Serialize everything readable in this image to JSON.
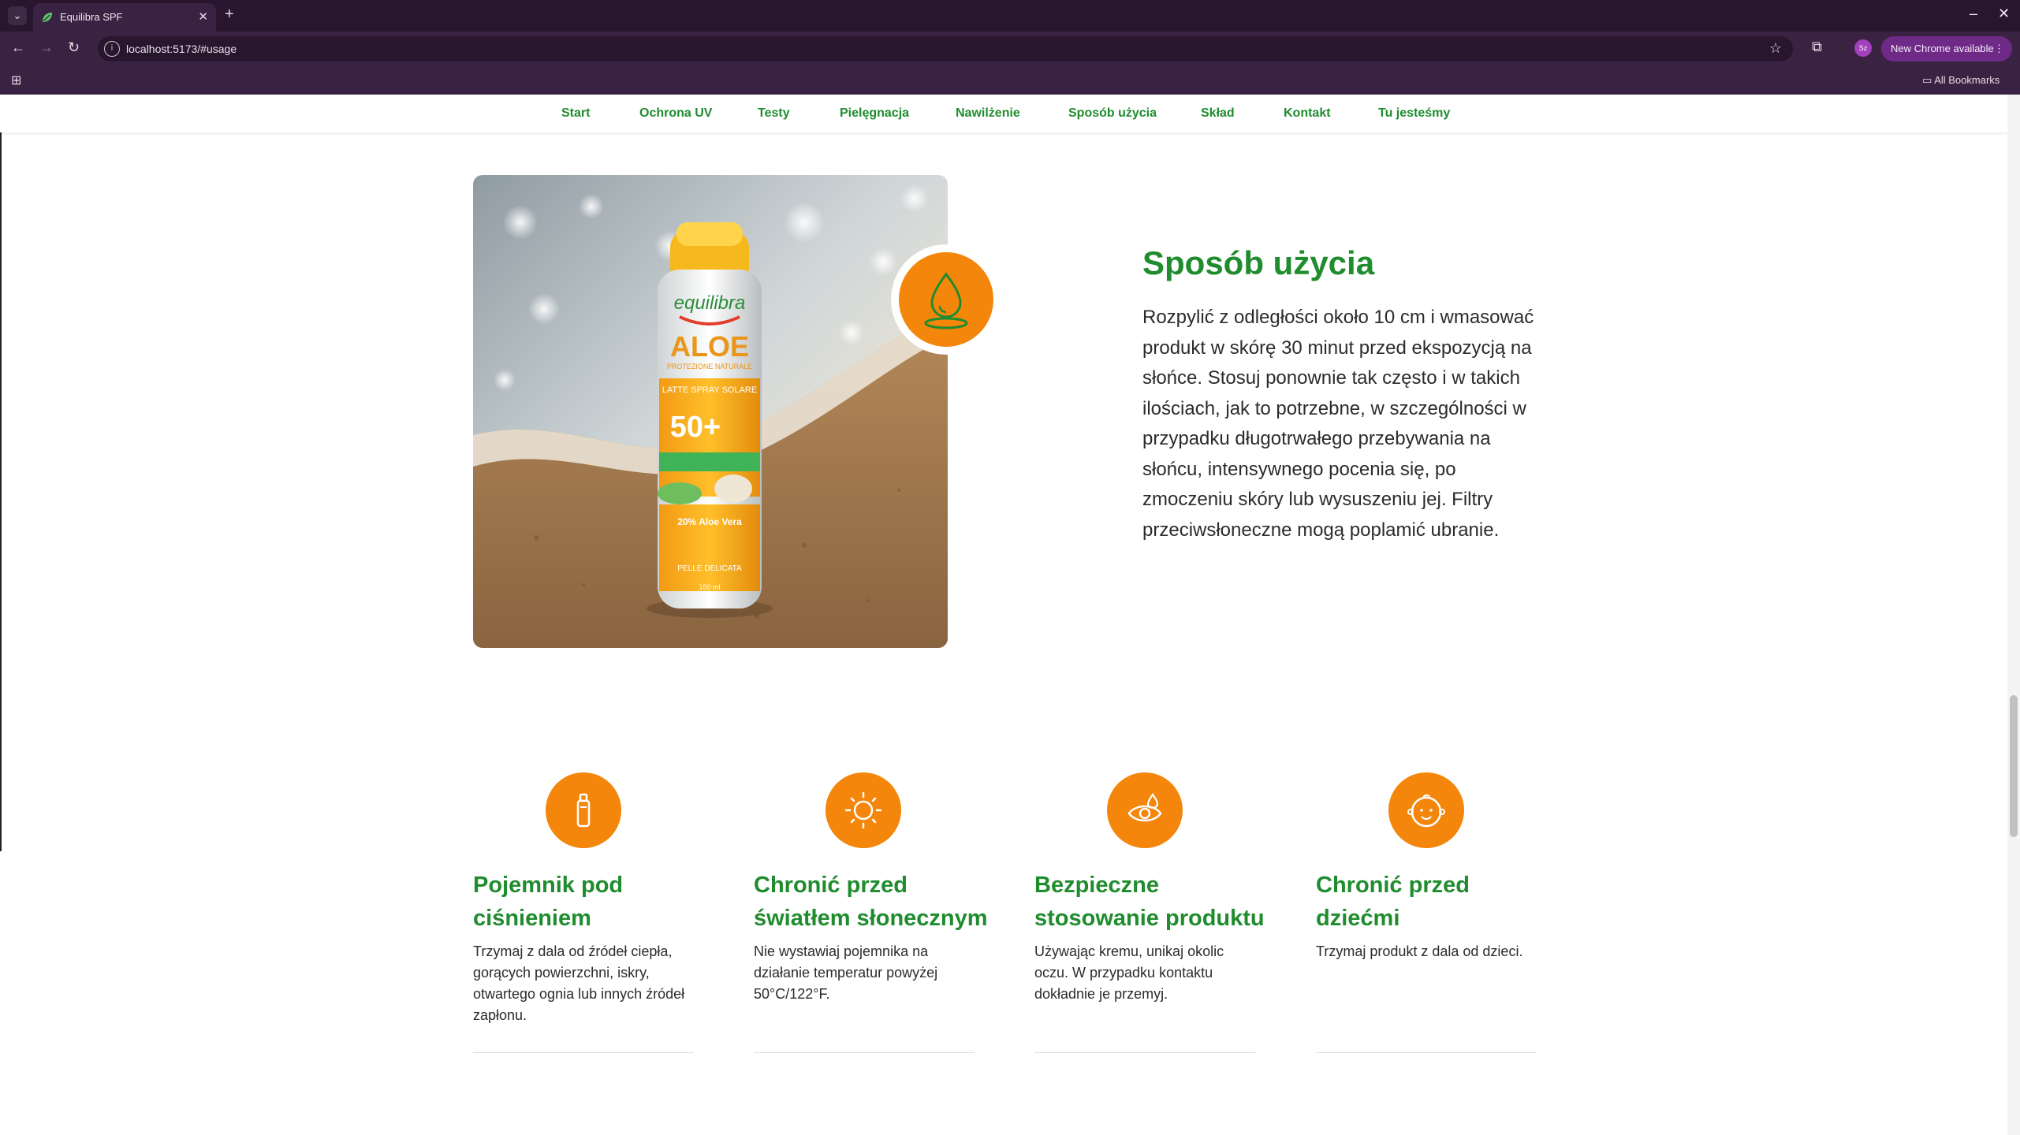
{
  "browser": {
    "tab_title": "Equilibra SPF",
    "url": "localhost:5173/#usage",
    "update_label": "New Chrome available",
    "profile_initials": "Sz",
    "all_bookmarks": "All Bookmarks"
  },
  "nav": {
    "items": [
      "Start",
      "Ochrona UV",
      "Testy",
      "Pielęgnacja",
      "Nawilżenie",
      "Sposób użycia",
      "Skład",
      "Kontakt",
      "Tu jesteśmy"
    ]
  },
  "usage": {
    "title": "Sposób użycia",
    "text": "Rozpylić z odległości około 10 cm i wmasować produkt w skórę 30 minut przed ekspozycją na słońce. Stosuj ponownie tak często i w takich ilościach, jak to potrzebne, w szczególności w przypadku długotrwałego przebywania na słońcu, intensywnego pocenia się, po zmoczeniu skóry lub wysuszeniu jej. Filtry przeciwsłoneczne mogą poplamić ubranie."
  },
  "product": {
    "brand": "equilibra",
    "name": "ALOE",
    "subtitle": "PROTEZIONE NATURALE",
    "type": "LATTE SPRAY SOLARE",
    "spf": "50+",
    "aloe": "20% Aloe Vera",
    "skin": "PELLE DELICATA",
    "volume": "150 ml"
  },
  "features": [
    {
      "title": "Pojemnik pod ciśnieniem",
      "text": "Trzymaj z dala od źródeł ciepła, gorących powierzchni, iskry, otwartego ognia lub innych źródeł zapłonu.",
      "icon": "spray-can-icon"
    },
    {
      "title": "Chronić przed światłem słonecznym",
      "text": "Nie wystawiaj pojemnika na działanie temperatur powyżej 50°C/122°F.",
      "icon": "sun-icon"
    },
    {
      "title": "Bezpieczne stosowanie produktu",
      "text": "Używając kremu, unikaj okolic oczu. W przypadku kontaktu dokładnie je przemyj.",
      "icon": "eye-drop-icon"
    },
    {
      "title": "Chronić przed dziećmi",
      "text": "Trzymaj produkt z dala od dzieci.",
      "icon": "baby-face-icon"
    }
  ],
  "colors": {
    "accent_green": "#1f8c2e",
    "accent_orange": "#f3860b",
    "chrome_dark": "#27162e",
    "chrome": "#3a2342"
  }
}
